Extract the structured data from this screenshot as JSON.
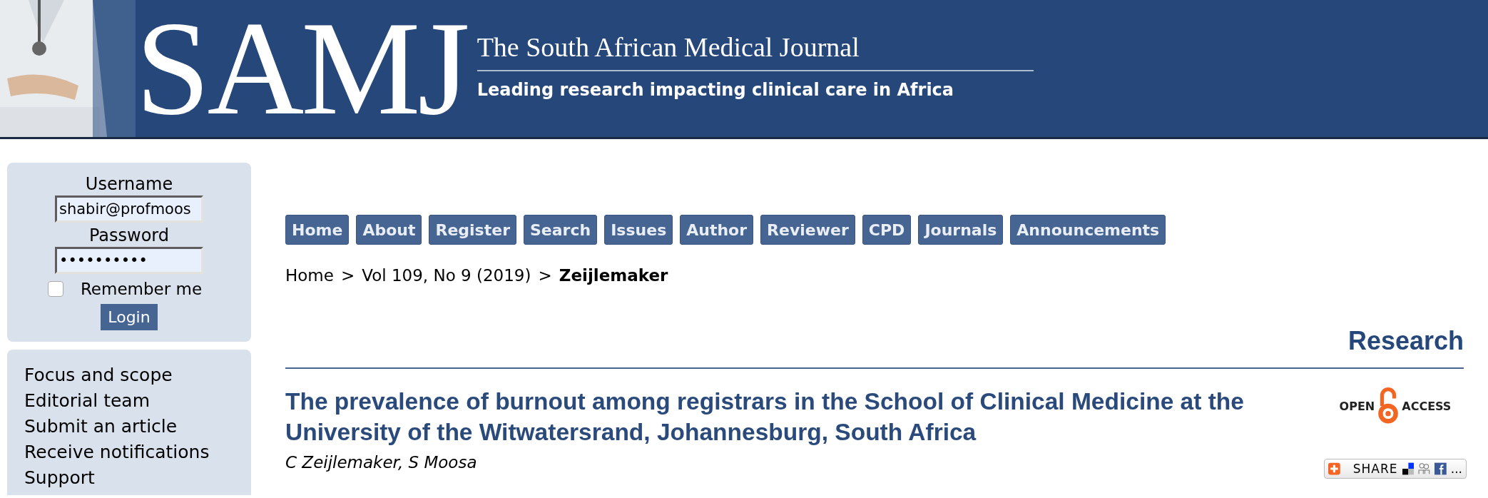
{
  "header": {
    "logo": "SAMJ",
    "title": "The South African Medical Journal",
    "tagline": "Leading research impacting clinical care in Africa"
  },
  "login": {
    "username_label": "Username",
    "username": "shabir@profmoos",
    "password_label": "Password",
    "password": "••••••••••",
    "remember": {
      "label": "Remember me",
      "checked": false
    },
    "button": "Login"
  },
  "sidebar": {
    "items": [
      "Focus and scope",
      "Editorial team",
      "Submit an article",
      "Receive notifications",
      "Support"
    ]
  },
  "nav": [
    "Home",
    "About",
    "Register",
    "Search",
    "Issues",
    "Author",
    "Reviewer",
    "CPD",
    "Journals",
    "Announcements"
  ],
  "breadcrumb": [
    {
      "label": "Home",
      "current": false
    },
    {
      "label": "Vol 109, No 9 (2019)",
      "current": false
    },
    {
      "label": "Zeijlemaker",
      "current": true
    }
  ],
  "breadcrumb_separator": ">",
  "section": "Research",
  "article": {
    "title": "The prevalence of burnout among registrars in the School of Clinical Medicine at the University of the Witwatersrand, Johannesburg, South Africa",
    "authors": "C Zeijlemaker, S Moosa"
  },
  "open_access": {
    "left": "OPEN",
    "right": "ACCESS"
  },
  "share": {
    "label": "SHARE",
    "more": "..."
  }
}
